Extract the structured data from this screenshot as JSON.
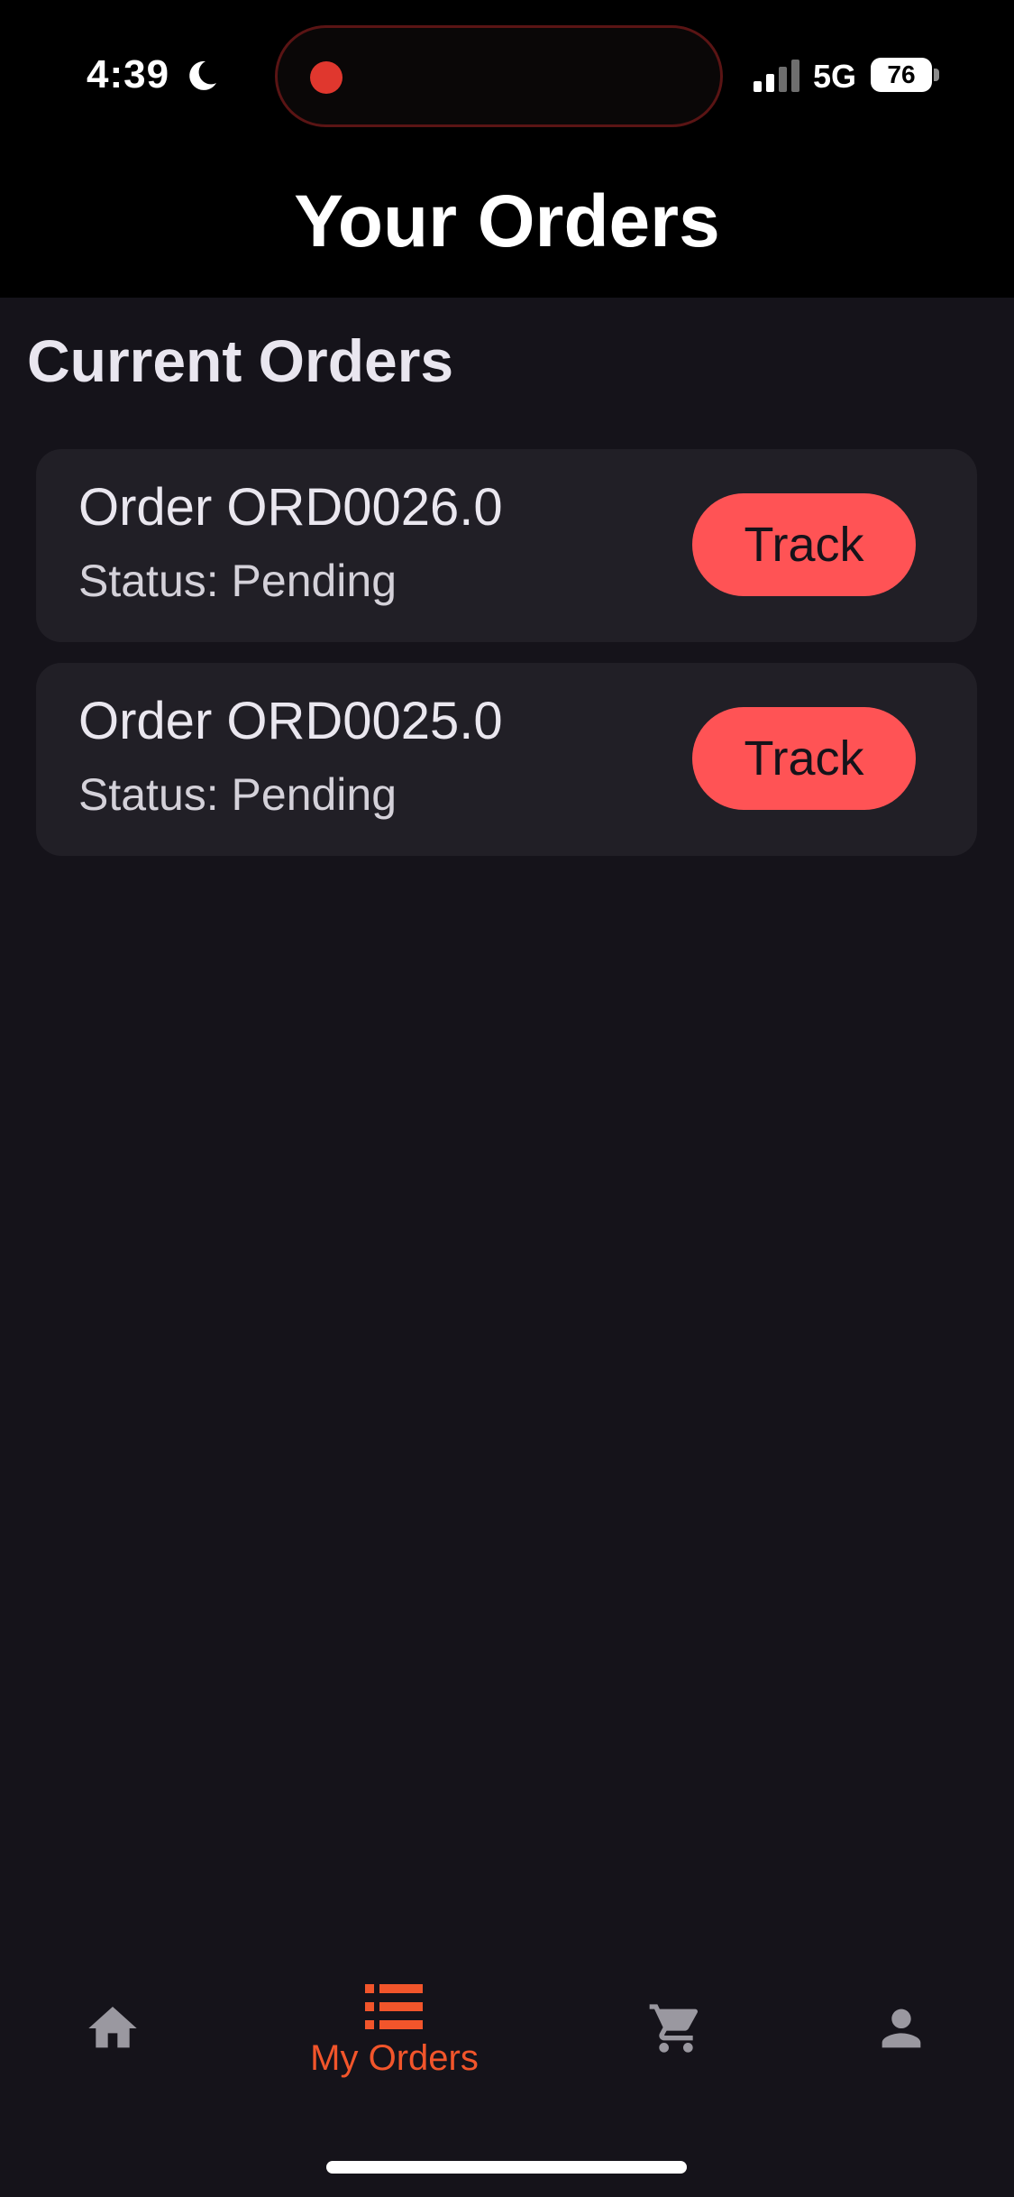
{
  "status_bar": {
    "time": "4:39",
    "network": "5G",
    "battery": "76"
  },
  "header": {
    "title": "Your Orders"
  },
  "main": {
    "section_title": "Current Orders",
    "orders": [
      {
        "title": "Order ORD0026.0",
        "status": "Status: Pending",
        "button_label": "Track"
      },
      {
        "title": "Order ORD0025.0",
        "status": "Status: Pending",
        "button_label": "Track"
      }
    ]
  },
  "bottom_nav": {
    "items": [
      {
        "icon": "home-icon",
        "label": ""
      },
      {
        "icon": "list-icon",
        "label": "My Orders",
        "active": true
      },
      {
        "icon": "cart-icon",
        "label": ""
      },
      {
        "icon": "person-icon",
        "label": ""
      }
    ]
  },
  "colors": {
    "accent": "#ff5355",
    "nav_active": "#f2552b",
    "background": "#15131a",
    "card": "#211f26",
    "header_bg": "#000000",
    "nav_inactive": "#9a98a0"
  }
}
